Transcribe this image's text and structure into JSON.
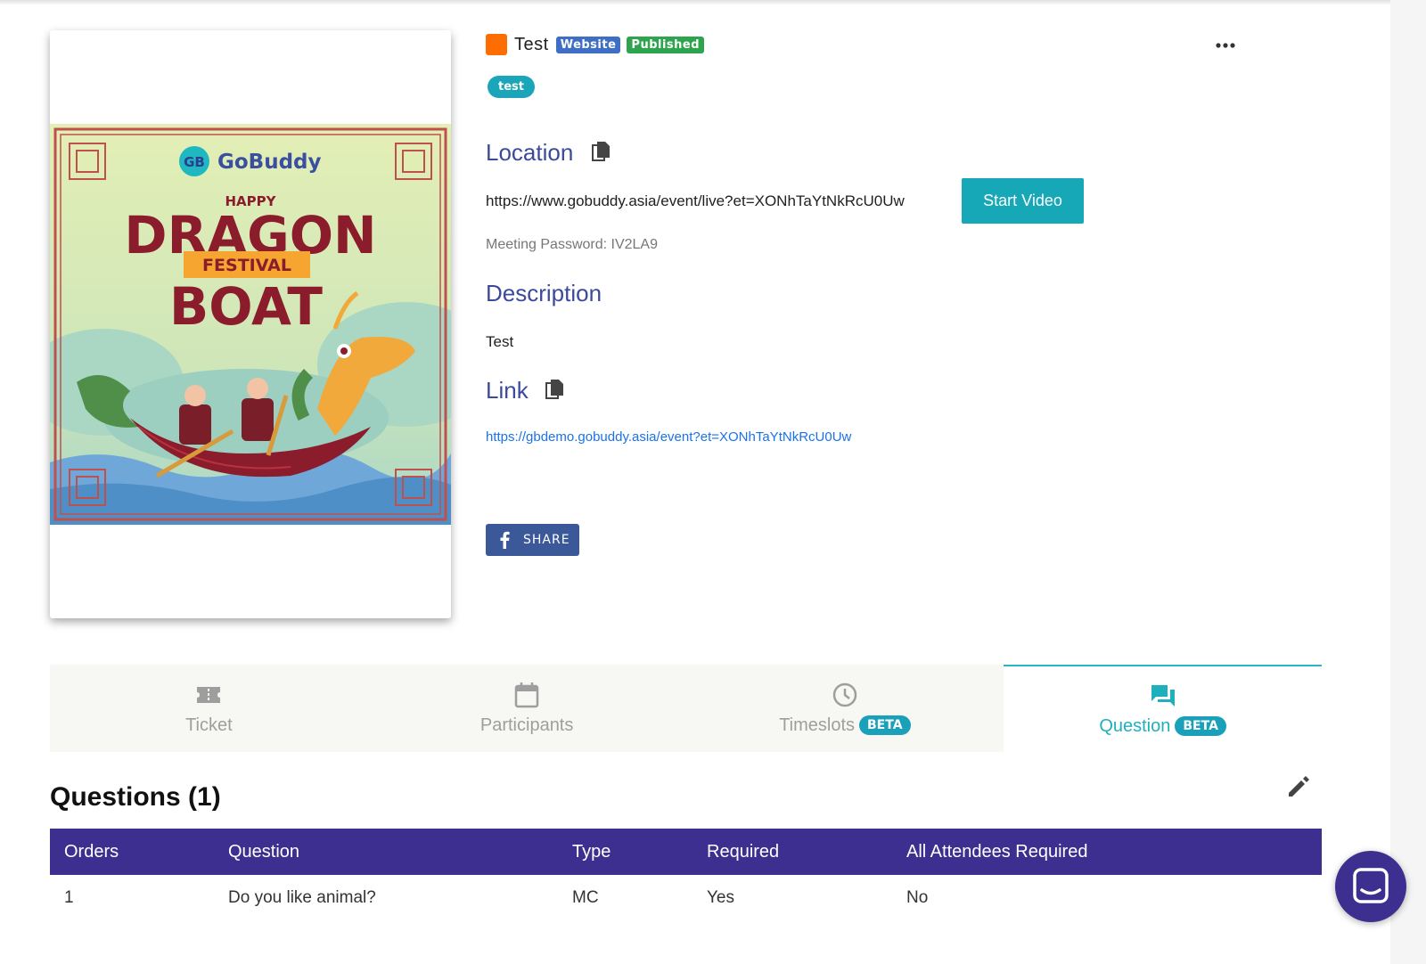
{
  "event": {
    "title": "Test",
    "badges": {
      "website": "Website",
      "published": "Published"
    },
    "tag": "test",
    "color_square": "#ff6d00"
  },
  "poster": {
    "brand": "GoBuddy",
    "logo_letters": "GB",
    "line1": "HAPPY",
    "line2": "DRAGON",
    "line3": "FESTIVAL",
    "line4": "BOAT"
  },
  "location": {
    "heading": "Location",
    "url": "https://www.gobuddy.asia/event/live?et=XONhTaYtNkRcU0Uw",
    "start_button": "Start Video",
    "meeting_password": "Meeting Password: IV2LA9"
  },
  "description": {
    "heading": "Description",
    "text": "Test"
  },
  "link": {
    "heading": "Link",
    "url": "https://gbdemo.gobuddy.asia/event?et=XONhTaYtNkRcU0Uw"
  },
  "share": {
    "label": "SHARE"
  },
  "tabs": [
    {
      "label": "Ticket",
      "icon": "ticket-icon"
    },
    {
      "label": "Participants",
      "icon": "calendar-icon"
    },
    {
      "label": "Timeslots",
      "badge": "BETA",
      "icon": "clock-icon"
    },
    {
      "label": "Question",
      "badge": "BETA",
      "icon": "forum-icon",
      "active": true
    }
  ],
  "questions": {
    "heading": "Questions (1)",
    "columns": [
      "Orders",
      "Question",
      "Type",
      "Required",
      "All Attendees Required"
    ],
    "rows": [
      [
        "1",
        "Do you like animal?",
        "MC",
        "Yes",
        "No"
      ]
    ]
  },
  "colors": {
    "accent": "#17a8b8",
    "heading_blue": "#3b4a9c",
    "table_header": "#3d2f8f",
    "facebook": "#3b5998",
    "published_green": "#2ea44f",
    "website_blue": "#3f6fc4"
  }
}
